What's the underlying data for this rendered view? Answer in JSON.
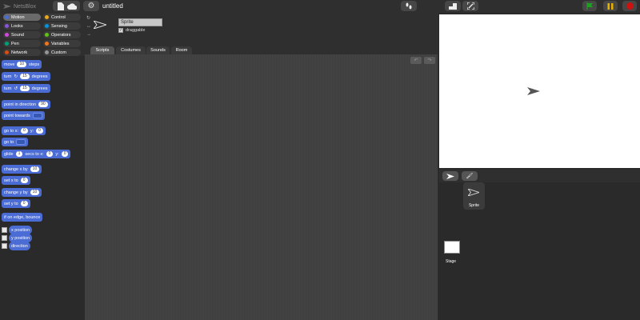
{
  "app": {
    "logo_text": "NetsBlox",
    "project_title": "untitled"
  },
  "toolbar": {
    "file_icon": "file-icon",
    "cloud_icon": "cloud-icon",
    "settings_icon": "gear-icon",
    "step_icon": "footsteps-icon",
    "stage_size_icon": "normal-stage-icon",
    "presentation_icon": "fullscreen-icon",
    "green_flag_color": "#1fa01f",
    "pause_color": "#e8b000",
    "stop_color": "#cc1111"
  },
  "categories": [
    {
      "label": "Motion",
      "color": "#4a6cd4",
      "active": true
    },
    {
      "label": "Control",
      "color": "#e6a822"
    },
    {
      "label": "Looks",
      "color": "#8a55d7"
    },
    {
      "label": "Sensing",
      "color": "#0494dc"
    },
    {
      "label": "Sound",
      "color": "#cf4ad9"
    },
    {
      "label": "Operators",
      "color": "#62c213"
    },
    {
      "label": "Pen",
      "color": "#00a178"
    },
    {
      "label": "Variables",
      "color": "#f3761d"
    },
    {
      "label": "Network",
      "color": "#d94d11"
    },
    {
      "label": "Custom",
      "color": "#969696"
    }
  ],
  "blocks": {
    "move": {
      "label": "move",
      "value": "10",
      "suffix": "steps"
    },
    "turn_cw": {
      "label": "turn",
      "value": "15",
      "suffix": "degrees"
    },
    "turn_ccw": {
      "label": "turn",
      "value": "15",
      "suffix": "degrees"
    },
    "point_dir": {
      "label": "point in direction",
      "value": "90"
    },
    "point_towards": {
      "label": "point towards"
    },
    "goto_xy": {
      "label": "go to x:",
      "x": "0",
      "ylabel": "y:",
      "y": "0"
    },
    "goto": {
      "label": "go to"
    },
    "glide": {
      "label": "glide",
      "secs": "1",
      "mid": "secs to x:",
      "x": "0",
      "ylabel": "y:",
      "y": "0"
    },
    "change_x": {
      "label": "change x by",
      "value": "10"
    },
    "set_x": {
      "label": "set x to",
      "value": "0"
    },
    "change_y": {
      "label": "change y by",
      "value": "10"
    },
    "set_y": {
      "label": "set y to",
      "value": "0"
    },
    "bounce": {
      "label": "if on edge, bounce"
    },
    "x_pos": {
      "label": "x position"
    },
    "y_pos": {
      "label": "y position"
    },
    "direction": {
      "label": "direction"
    }
  },
  "sprite": {
    "name": "Sprite",
    "draggable_label": "draggable",
    "draggable_mark": "✓"
  },
  "tabs": [
    {
      "label": "Scripts",
      "active": true
    },
    {
      "label": "Costumes"
    },
    {
      "label": "Sounds"
    },
    {
      "label": "Room"
    }
  ],
  "corral": {
    "sprite_label": "Sprite",
    "stage_label": "Stage"
  }
}
